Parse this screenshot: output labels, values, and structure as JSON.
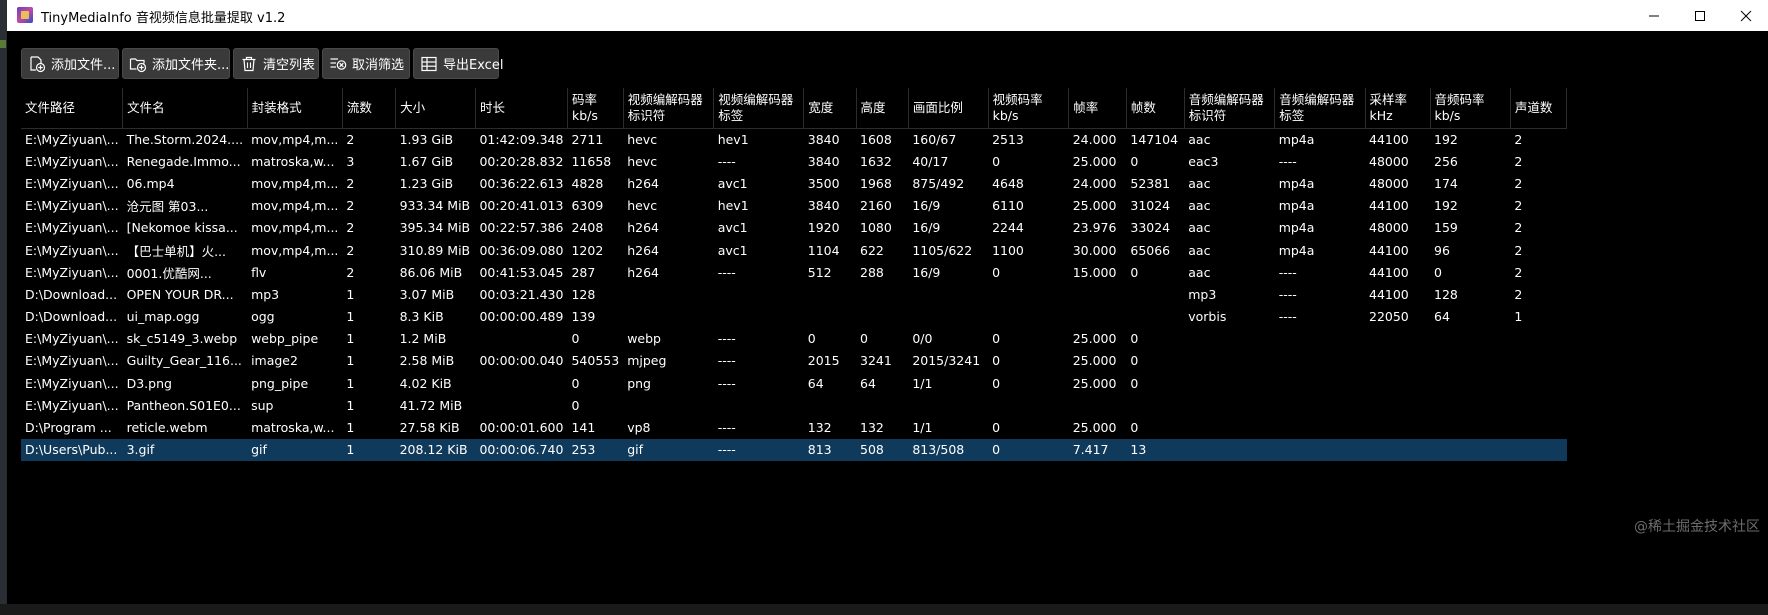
{
  "window": {
    "title": "TinyMediaInfo 音视频信息批量提取 v1.2",
    "controls": {
      "minimize": "minimize-icon",
      "maximize": "maximize-icon",
      "close": "close-icon"
    }
  },
  "toolbar": {
    "add_files": "添加文件...",
    "add_folder": "添加文件夹...",
    "clear_list": "清空列表",
    "cancel_filter": "取消筛选",
    "export_excel": "导出Excel"
  },
  "table": {
    "columns": [
      "文件路径",
      "文件名",
      "封装格式",
      "流数",
      "大小",
      "时长",
      "码率\nkb/s",
      "视频编解码器\n标识符",
      "视频编解码器\n标签",
      "宽度",
      "高度",
      "画面比例",
      "视频码率\nkb/s",
      "帧率",
      "帧数",
      "音频编解码器\n标识符",
      "音频编解码器\n标签",
      "采样率\nkHz",
      "音频码率\nkb/s",
      "声道数"
    ],
    "rows": [
      [
        "E:\\MyZiyuan\\...",
        "The.Storm.2024....",
        "mov,mp4,m...",
        "2",
        "1.93 GiB",
        "01:42:09.348",
        "2711",
        "hevc",
        "hev1",
        "3840",
        "1608",
        "160/67",
        "2513",
        "24.000",
        "147104",
        "aac",
        "mp4a",
        "44100",
        "192",
        "2"
      ],
      [
        "E:\\MyZiyuan\\...",
        "Renegade.Immo...",
        "matroska,w...",
        "3",
        "1.67 GiB",
        "00:20:28.832",
        "11658",
        "hevc",
        "----",
        "3840",
        "1632",
        "40/17",
        "0",
        "25.000",
        "0",
        "eac3",
        "----",
        "48000",
        "256",
        "2"
      ],
      [
        "E:\\MyZiyuan\\...",
        "06.mp4",
        "mov,mp4,m...",
        "2",
        "1.23 GiB",
        "00:36:22.613",
        "4828",
        "h264",
        "avc1",
        "3500",
        "1968",
        "875/492",
        "4648",
        "24.000",
        "52381",
        "aac",
        "mp4a",
        "48000",
        "174",
        "2"
      ],
      [
        "E:\\MyZiyuan\\...",
        "沧元图 第03...",
        "mov,mp4,m...",
        "2",
        "933.34 MiB",
        "00:20:41.013",
        "6309",
        "hevc",
        "hev1",
        "3840",
        "2160",
        "16/9",
        "6110",
        "25.000",
        "31024",
        "aac",
        "mp4a",
        "44100",
        "192",
        "2"
      ],
      [
        "E:\\MyZiyuan\\...",
        "[Nekomoe kissa...",
        "mov,mp4,m...",
        "2",
        "395.34 MiB",
        "00:22:57.386",
        "2408",
        "h264",
        "avc1",
        "1920",
        "1080",
        "16/9",
        "2244",
        "23.976",
        "33024",
        "aac",
        "mp4a",
        "48000",
        "159",
        "2"
      ],
      [
        "E:\\MyZiyuan\\...",
        "【巴士单机】火...",
        "mov,mp4,m...",
        "2",
        "310.89 MiB",
        "00:36:09.080",
        "1202",
        "h264",
        "avc1",
        "1104",
        "622",
        "1105/622",
        "1100",
        "30.000",
        "65066",
        "aac",
        "mp4a",
        "44100",
        "96",
        "2"
      ],
      [
        "E:\\MyZiyuan\\...",
        "0001.优酷网...",
        "flv",
        "2",
        "86.06 MiB",
        "00:41:53.045",
        "287",
        "h264",
        "----",
        "512",
        "288",
        "16/9",
        "0",
        "15.000",
        "0",
        "aac",
        "----",
        "44100",
        "0",
        "2"
      ],
      [
        "D:\\Download...",
        "OPEN YOUR DR...",
        "mp3",
        "1",
        "3.07 MiB",
        "00:03:21.430",
        "128",
        "",
        "",
        "",
        "",
        "",
        "",
        "",
        "",
        "mp3",
        "----",
        "44100",
        "128",
        "2"
      ],
      [
        "D:\\Download...",
        "ui_map.ogg",
        "ogg",
        "1",
        "8.3 KiB",
        "00:00:00.489",
        "139",
        "",
        "",
        "",
        "",
        "",
        "",
        "",
        "",
        "vorbis",
        "----",
        "22050",
        "64",
        "1"
      ],
      [
        "E:\\MyZiyuan\\...",
        "sk_c5149_3.webp",
        "webp_pipe",
        "1",
        "1.2 MiB",
        "",
        "0",
        "webp",
        "----",
        "0",
        "0",
        "0/0",
        "0",
        "25.000",
        "0",
        "",
        "",
        "",
        "",
        ""
      ],
      [
        "E:\\MyZiyuan\\...",
        "Guilty_Gear_116...",
        "image2",
        "1",
        "2.58 MiB",
        "00:00:00.040",
        "540553",
        "mjpeg",
        "----",
        "2015",
        "3241",
        "2015/3241",
        "0",
        "25.000",
        "0",
        "",
        "",
        "",
        "",
        ""
      ],
      [
        "E:\\MyZiyuan\\...",
        "D3.png",
        "png_pipe",
        "1",
        "4.02 KiB",
        "",
        "0",
        "png",
        "----",
        "64",
        "64",
        "1/1",
        "0",
        "25.000",
        "0",
        "",
        "",
        "",
        "",
        ""
      ],
      [
        "E:\\MyZiyuan\\...",
        "Pantheon.S01E0...",
        "sup",
        "1",
        "41.72 MiB",
        "",
        "0",
        "",
        "",
        "",
        "",
        "",
        "",
        "",
        "",
        "",
        "",
        "",
        "",
        ""
      ],
      [
        "D:\\Program ...",
        "reticle.webm",
        "matroska,w...",
        "1",
        "27.58 KiB",
        "00:00:01.600",
        "141",
        "vp8",
        "----",
        "132",
        "132",
        "1/1",
        "0",
        "25.000",
        "0",
        "",
        "",
        "",
        "",
        ""
      ],
      [
        "D:\\Users\\Pub...",
        "3.gif",
        "gif",
        "1",
        "208.12 KiB",
        "00:00:06.740",
        "253",
        "gif",
        "----",
        "813",
        "508",
        "813/508",
        "0",
        "7.417",
        "13",
        "",
        "",
        "",
        "",
        ""
      ]
    ],
    "selected_row": 14
  },
  "watermark": "@稀土掘金技术社区",
  "colors": {
    "background": "#000000",
    "selected_row": "#0f3a5c",
    "button_bg": "#3a3a3a",
    "titlebar": "#ffffff"
  }
}
